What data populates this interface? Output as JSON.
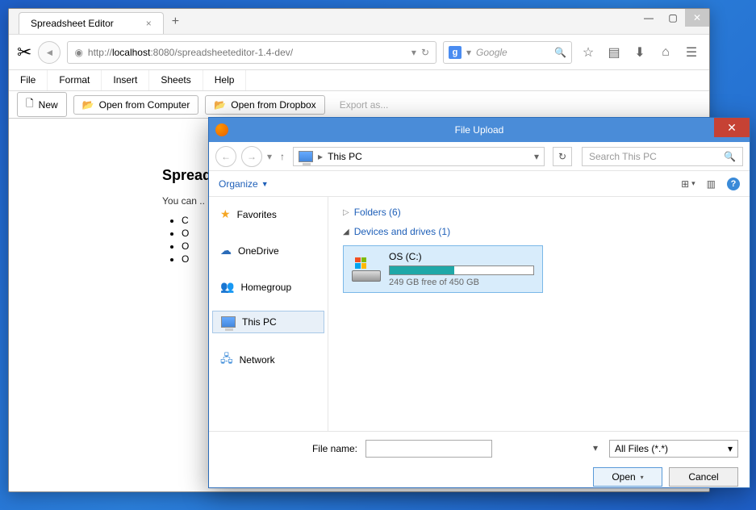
{
  "browser": {
    "tab_title": "Spreadsheet Editor",
    "url_prefix": "http://",
    "url_host": "localhost",
    "url_port": ":8080",
    "url_path": "/spreadsheeteditor-1.4-dev/",
    "search_placeholder": "Google",
    "search_badge": "g"
  },
  "menus": [
    "File",
    "Format",
    "Insert",
    "Sheets",
    "Help"
  ],
  "toolbar": {
    "new": "New",
    "open_computer": "Open from Computer",
    "open_dropbox": "Open from Dropbox",
    "export": "Export as..."
  },
  "card": {
    "title": "Spread",
    "intro": "You can ..",
    "bullets": [
      "C",
      "O",
      "O",
      "O"
    ]
  },
  "dialog": {
    "title": "File Upload",
    "crumb": "This PC",
    "search_placeholder": "Search This PC",
    "organize": "Organize",
    "tree": {
      "favorites": "Favorites",
      "onedrive": "OneDrive",
      "homegroup": "Homegroup",
      "thispc": "This PC",
      "network": "Network"
    },
    "folders_hdr": "Folders (6)",
    "devices_hdr": "Devices and drives (1)",
    "drive": {
      "name": "OS (C:)",
      "free": "249 GB free of 450 GB"
    },
    "filename_label": "File name:",
    "filter": "All Files (*.*)",
    "open": "Open",
    "cancel": "Cancel"
  }
}
